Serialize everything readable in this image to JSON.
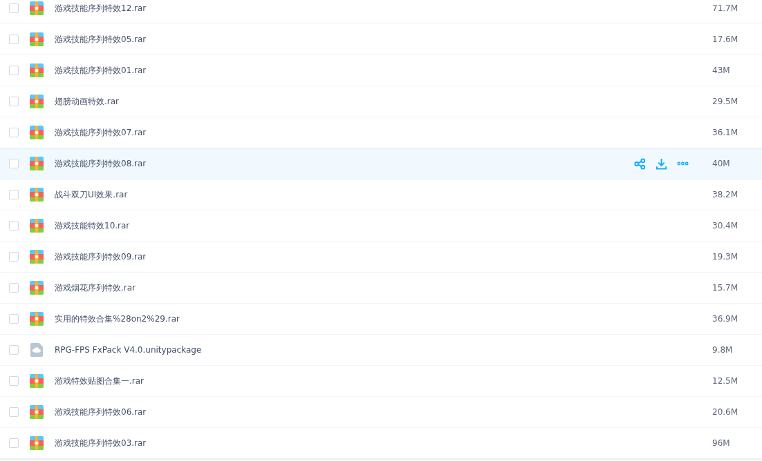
{
  "files": [
    {
      "name": "游戏技能序列特效12.rar",
      "size": "71.7M",
      "kind": "archive",
      "hovered": false,
      "checked": false
    },
    {
      "name": "游戏技能序列特效05.rar",
      "size": "17.6M",
      "kind": "archive",
      "hovered": false,
      "checked": false
    },
    {
      "name": "游戏技能序列特效01.rar",
      "size": "43M",
      "kind": "archive",
      "hovered": false,
      "checked": false
    },
    {
      "name": "翅膀动画特效.rar",
      "size": "29.5M",
      "kind": "archive",
      "hovered": false,
      "checked": false
    },
    {
      "name": "游戏技能序列特效07.rar",
      "size": "36.1M",
      "kind": "archive",
      "hovered": false,
      "checked": false
    },
    {
      "name": "游戏技能序列特效08.rar",
      "size": "40M",
      "kind": "archive",
      "hovered": true,
      "checked": false
    },
    {
      "name": "战斗双刀UI效果.rar",
      "size": "38.2M",
      "kind": "archive",
      "hovered": false,
      "checked": false
    },
    {
      "name": "游戏技能特效10.rar",
      "size": "30.4M",
      "kind": "archive",
      "hovered": false,
      "checked": false
    },
    {
      "name": "游戏技能序列特效09.rar",
      "size": "19.3M",
      "kind": "archive",
      "hovered": false,
      "checked": false
    },
    {
      "name": "游戏烟花序列特效.rar",
      "size": "15.7M",
      "kind": "archive",
      "hovered": false,
      "checked": false
    },
    {
      "name": "实用的特效合集%28on2%29.rar",
      "size": "36.9M",
      "kind": "archive",
      "hovered": false,
      "checked": false
    },
    {
      "name": "RPG-FPS FxPack V4.0.unitypackage",
      "size": "9.8M",
      "kind": "file",
      "hovered": false,
      "checked": false
    },
    {
      "name": "游戏特效贴图合集一.rar",
      "size": "12.5M",
      "kind": "archive",
      "hovered": false,
      "checked": false
    },
    {
      "name": "游戏技能序列特效06.rar",
      "size": "20.6M",
      "kind": "archive",
      "hovered": false,
      "checked": false
    },
    {
      "name": "游戏技能序列特效03.rar",
      "size": "96M",
      "kind": "archive",
      "hovered": false,
      "checked": false
    }
  ]
}
